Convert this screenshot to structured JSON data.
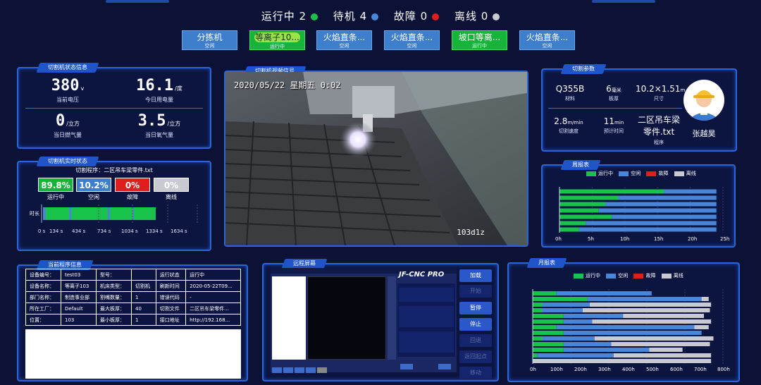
{
  "status": {
    "running_label": "运行中 2",
    "standby_label": "待机 4",
    "fault_label": "故障 0",
    "offline_label": "离线 0",
    "colors": {
      "running": "#19c24a",
      "standby": "#4a86d8",
      "fault": "#e01e1e",
      "offline": "#c9c9d1"
    }
  },
  "machines": [
    {
      "name": "分拣机",
      "state": "空闲",
      "style": "blue"
    },
    {
      "name": "等离子10...",
      "state": "运行中",
      "style": "green-pill"
    },
    {
      "name": "火焰直条...",
      "state": "空闲",
      "style": "blue"
    },
    {
      "name": "火焰直条...",
      "state": "空闲",
      "style": "blue"
    },
    {
      "name": "坡口等离...",
      "state": "运行中",
      "style": "green"
    },
    {
      "name": "火焰直条...",
      "state": "空闲",
      "style": "blue"
    }
  ],
  "machine_status": {
    "title": "切割机状态信息",
    "voltage": {
      "value": "380",
      "unit": "v",
      "caption": "当前电压"
    },
    "power": {
      "value": "16.1",
      "unit": "/度",
      "caption": "今日用电量"
    },
    "gas": {
      "value": "0",
      "unit": "/立方",
      "caption": "当日燃气量"
    },
    "oxygen": {
      "value": "3.5",
      "unit": "/立方",
      "caption": "当日氧气量"
    }
  },
  "realtime": {
    "title": "切割机实时状态",
    "program": "切割程序：二区吊车梁零件.txt",
    "running": {
      "value": "89.8%",
      "label": "运行中"
    },
    "idle": {
      "value": "10.2%",
      "label": "空闲"
    },
    "fault": {
      "value": "0%",
      "label": "故障"
    },
    "offline": {
      "value": "0%",
      "label": "离线"
    },
    "timeline_label": "时长",
    "ticks": [
      "0 s",
      "134 s",
      "434 s",
      "734 s",
      "1034 s",
      "1334 s",
      "1634 s"
    ]
  },
  "video": {
    "title": "切割机视频信号",
    "timestamp": "2020/05/22 星期五 0",
    "timestamp_tail": "02",
    "watermark": "103d1z"
  },
  "params": {
    "title": "切割参数",
    "material": {
      "value": "Q355B",
      "caption": "材料"
    },
    "thickness": {
      "value": "6",
      "unit": "毫米",
      "caption": "板厚"
    },
    "size": {
      "value": "10.2×1.51",
      "unit": "m",
      "caption": "尺寸"
    },
    "speed": {
      "value": "2.8",
      "unit": "m/min",
      "caption": "切割速度"
    },
    "est_time": {
      "value": "11",
      "unit": "min",
      "caption": "预计时间"
    },
    "program": {
      "value": "二区吊车梁零件.txt",
      "caption": "程序"
    },
    "operator": "张越昊"
  },
  "weekly": {
    "title": "周报表",
    "legend": [
      "运行中",
      "空闲",
      "故障",
      "离线"
    ],
    "x_ticks": [
      "0h",
      "5h",
      "10h",
      "15h",
      "20h",
      "25h"
    ]
  },
  "program_info": {
    "title": "当前程序信息",
    "rows": [
      [
        "设备编号：",
        "test03",
        "型号：",
        "",
        "运行状态",
        "运行中"
      ],
      [
        "设备名称：",
        "等离子103",
        "机床类型：",
        "切割机",
        "刷新时间",
        "2020-05-22T09..."
      ],
      [
        "部门名称：",
        "制造事业部",
        "割嘴数量：",
        "1",
        "错误代码",
        "-"
      ],
      [
        "所在工厂：",
        "Default",
        "最大板厚：",
        "40",
        "切割文件",
        "二区吊车梁零件..."
      ],
      [
        "位置：",
        "103",
        "最小板厚：",
        "1",
        "接口地址",
        "http://192.168..."
      ]
    ]
  },
  "remote": {
    "title": "远程屏幕",
    "brand": "JF-CNC PRO",
    "buttons": [
      "加载",
      "开始",
      "暂停",
      "停止",
      "回退",
      "返回起点",
      "移动"
    ]
  },
  "monthly": {
    "title": "月报表",
    "legend": [
      "运行中",
      "空闲",
      "故障",
      "离线"
    ],
    "x_ticks": [
      "0h",
      "100h",
      "200h",
      "300h",
      "400h",
      "500h",
      "600h",
      "700h",
      "800h"
    ]
  },
  "chart_data": [
    {
      "type": "bar",
      "title": "周报表",
      "orientation": "horizontal",
      "stacked": true,
      "xlim": [
        0,
        25
      ],
      "series": [
        {
          "name": "运行中",
          "color": "#19c24a",
          "values": [
            16,
            9,
            7,
            6,
            8,
            4,
            3
          ]
        },
        {
          "name": "空闲",
          "color": "#4a86d8",
          "values": [
            8,
            15,
            17,
            18,
            16,
            20,
            21
          ]
        },
        {
          "name": "故障",
          "color": "#e01e1e",
          "values": [
            0,
            0,
            0,
            0,
            0,
            0,
            0
          ]
        },
        {
          "name": "离线",
          "color": "#c9c9d1",
          "values": [
            0,
            0,
            0,
            0,
            0,
            0,
            0
          ]
        }
      ]
    },
    {
      "type": "bar",
      "title": "月报表",
      "orientation": "horizontal",
      "stacked": true,
      "xlim": [
        0,
        800
      ],
      "series": [
        {
          "name": "运行中",
          "color": "#19c24a",
          "values": [
            100,
            230,
            40,
            40,
            130,
            130,
            100,
            130,
            40,
            130,
            130,
            20,
            0
          ]
        },
        {
          "name": "空闲",
          "color": "#4a86d8",
          "values": [
            400,
            480,
            200,
            170,
            250,
            120,
            580,
            580,
            220,
            200,
            360,
            320,
            0
          ]
        },
        {
          "name": "故障",
          "color": "#e01e1e",
          "values": [
            0,
            0,
            0,
            0,
            0,
            0,
            0,
            0,
            0,
            0,
            0,
            0,
            0
          ]
        },
        {
          "name": "离线",
          "color": "#c9c9d1",
          "values": [
            0,
            30,
            510,
            535,
            340,
            500,
            60,
            0,
            500,
            415,
            140,
            410,
            750
          ]
        }
      ]
    }
  ]
}
